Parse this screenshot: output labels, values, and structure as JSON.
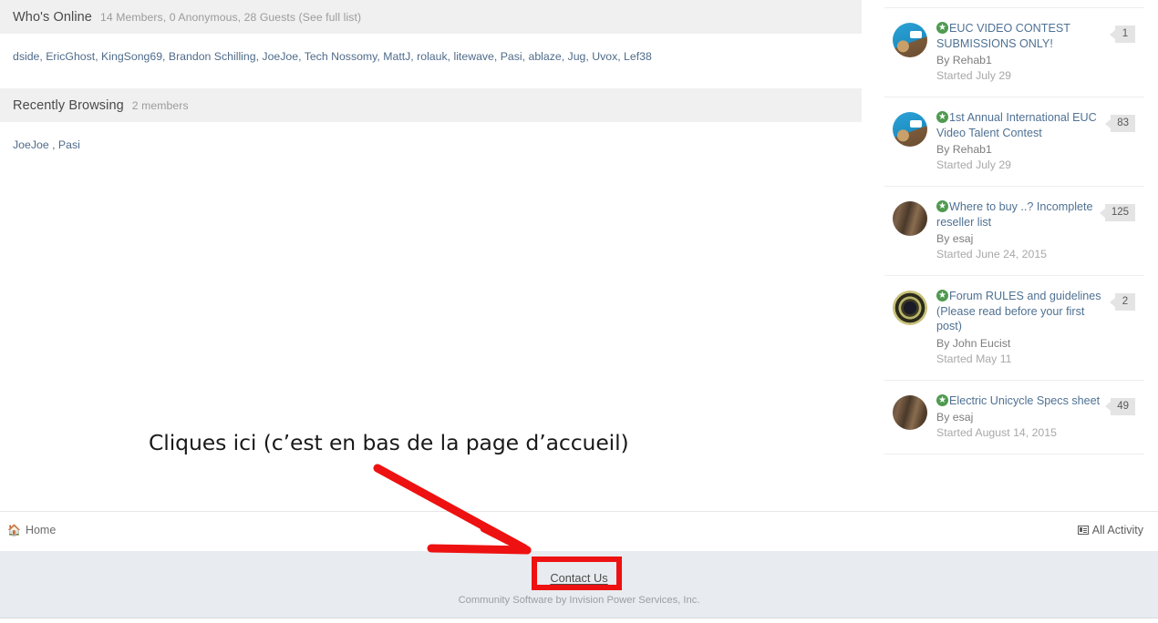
{
  "whos_online": {
    "title": "Who's Online",
    "subtitle": "14 Members, 0 Anonymous, 28 Guests (See full list)",
    "members": "dside, EricGhost, KingSong69, Brandon Schilling, JoeJoe, Tech Nossomy, MattJ, rolauk, litewave, Pasi, ablaze, Jug, Uvox, Lef38"
  },
  "recently_browsing": {
    "title": "Recently Browsing",
    "subtitle": "2 members",
    "members": "JoeJoe , Pasi"
  },
  "sidebar": {
    "topics": [
      {
        "title": "EUC VIDEO CONTEST SUBMISSIONS ONLY!",
        "by": "By Rehab1",
        "started": "Started July 29",
        "count": "1",
        "avatar": "av-blue",
        "icon": "pinned-star-icon"
      },
      {
        "title": "1st Annual International EUC Video Talent Contest",
        "by": "By Rehab1",
        "started": "Started July 29",
        "count": "83",
        "avatar": "av-blue",
        "icon": "pinned-star-icon"
      },
      {
        "title": "Where to buy ..? Incomplete reseller list",
        "by": "By esaj",
        "started": "Started June 24, 2015",
        "count": "125",
        "avatar": "av-hair",
        "icon": "pinned-star-icon"
      },
      {
        "title": "Forum RULES and guidelines (Please read before your first post)",
        "by": "By John Eucist",
        "started": "Started May 11",
        "count": "2",
        "avatar": "av-dark",
        "icon": "pinned-star-icon"
      },
      {
        "title": "Electric Unicycle Specs sheet",
        "by": "By esaj",
        "started": "Started August 14, 2015",
        "count": "49",
        "avatar": "av-hair",
        "icon": "pinned-star-icon"
      }
    ]
  },
  "breadcrumb": {
    "home_label": "Home",
    "home_icon": "home-icon",
    "all_activity_label": "All Activity",
    "all_activity_icon": "activity-feed-icon"
  },
  "footer": {
    "contact_label": "Contact Us",
    "copyright": "Community Software by Invision Power Services, Inc."
  },
  "annotation": {
    "text": "Cliques ici (c’est en bas de la page d’accueil)",
    "arrow_color": "#ee1111",
    "highlight_color": "#ee1111",
    "arrow_from": "415,515",
    "arrow_to": "578,604"
  },
  "colors": {
    "panel_header_bg": "#f0f0f1",
    "footer_bg": "#e8ebef",
    "link": "#4f7193",
    "badge_bg": "#e4e4e4",
    "annotation_red": "#ee1111"
  }
}
